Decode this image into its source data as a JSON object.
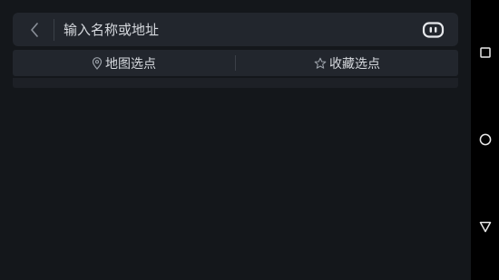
{
  "search": {
    "placeholder": "输入名称或地址",
    "back_icon": "chevron-left-icon",
    "voice_icon": "voice-assistant-icon"
  },
  "options": {
    "map_pick": {
      "label": "地图选点",
      "icon": "location-pin-icon"
    },
    "favorite_pick": {
      "label": "收藏选点",
      "icon": "star-outline-icon"
    }
  },
  "system_nav": {
    "recents_icon": "square-icon",
    "home_icon": "circle-icon",
    "back_icon": "triangle-back-icon"
  },
  "colors": {
    "background": "#14171b",
    "panel": "#22262d",
    "text": "#d6d9de",
    "icon": "#9aa0a8",
    "nav_bar": "#000000"
  }
}
